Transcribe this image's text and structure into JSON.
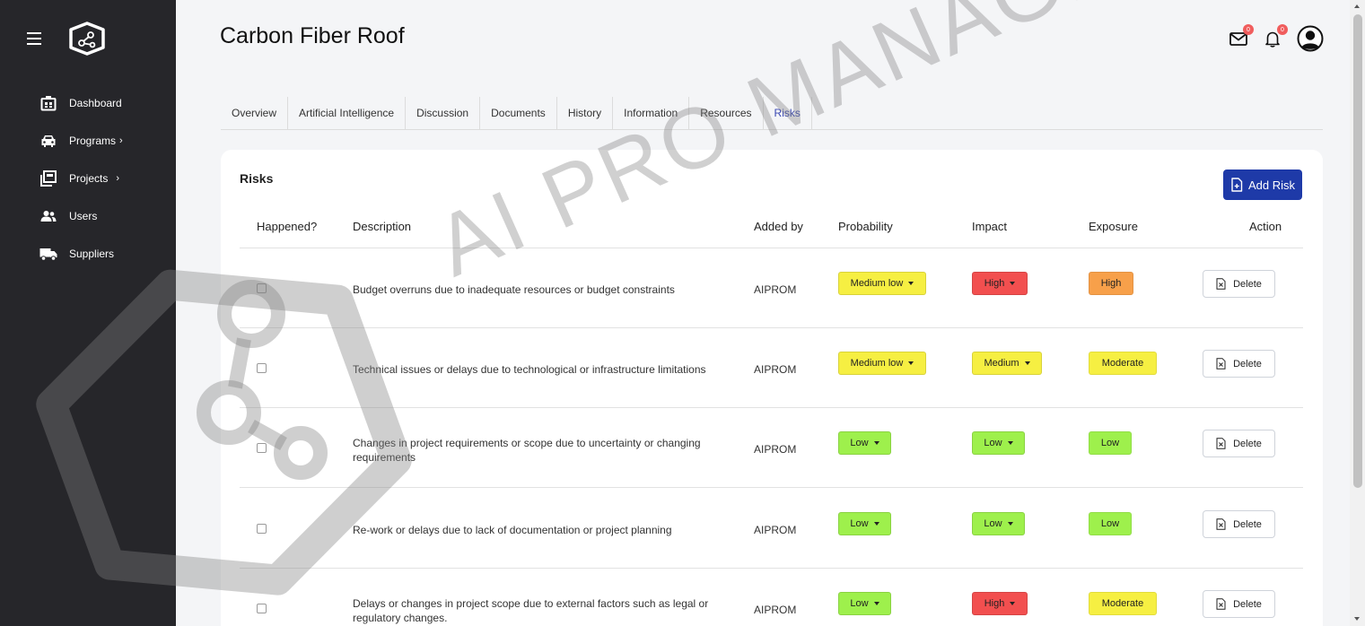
{
  "page": {
    "title": "Carbon Fiber Roof"
  },
  "header": {
    "mail_badge": "0",
    "bell_badge": "0"
  },
  "watermark": {
    "text": "AI PRO MANAGEMENT"
  },
  "sidebar": {
    "items": [
      {
        "label": "Dashboard",
        "icon": "dashboard-icon",
        "chevron": ""
      },
      {
        "label": "Programs",
        "icon": "car-icon",
        "chevron": "›"
      },
      {
        "label": "Projects",
        "icon": "projects-icon",
        "chevron": "›"
      },
      {
        "label": "Users",
        "icon": "users-icon",
        "chevron": ""
      },
      {
        "label": "Suppliers",
        "icon": "truck-icon",
        "chevron": ""
      }
    ]
  },
  "tabs": [
    {
      "label": "Overview"
    },
    {
      "label": "Artificial Intelligence"
    },
    {
      "label": "Discussion"
    },
    {
      "label": "Documents"
    },
    {
      "label": "History"
    },
    {
      "label": "Information"
    },
    {
      "label": "Resources"
    },
    {
      "label": "Risks",
      "active": true
    }
  ],
  "risks": {
    "title": "Risks",
    "add_label": "Add Risk",
    "columns": {
      "happened": "Happened?",
      "description": "Description",
      "added_by": "Added by",
      "probability": "Probability",
      "impact": "Impact",
      "exposure": "Exposure",
      "action": "Action"
    },
    "delete_label": "Delete",
    "rows": [
      {
        "description": "Budget overruns due to inadequate resources or budget constraints",
        "added_by": "AIPROM",
        "probability": "Medium low",
        "impact": "High",
        "exposure": "High"
      },
      {
        "description": "Technical issues or delays due to technological or infrastructure limitations",
        "added_by": "AIPROM",
        "probability": "Medium low",
        "impact": "Medium",
        "exposure": "Moderate"
      },
      {
        "description": "Changes in project requirements or scope due to uncertainty or changing requirements",
        "added_by": "AIPROM",
        "probability": "Low",
        "impact": "Low",
        "exposure": "Low"
      },
      {
        "description": "Re-work or delays due to lack of documentation or project planning",
        "added_by": "AIPROM",
        "probability": "Low",
        "impact": "Low",
        "exposure": "Low"
      },
      {
        "description": "Delays or changes in project scope due to external factors such as legal or regulatory changes.",
        "added_by": "AIPROM",
        "probability": "Low",
        "impact": "High",
        "exposure": "Moderate"
      }
    ]
  },
  "colors": {
    "sidebar_bg": "#26262a",
    "accent": "#1e3aa8",
    "tab_active": "#3b49b3",
    "level_high": "#f24f4f",
    "level_medium_low": "#f6ef42",
    "level_medium": "#f6ef42",
    "level_low": "#9ef04c",
    "exposure_high": "#f7a04a",
    "exposure_moderate": "#f6ef42",
    "exposure_low": "#9ef04c"
  }
}
